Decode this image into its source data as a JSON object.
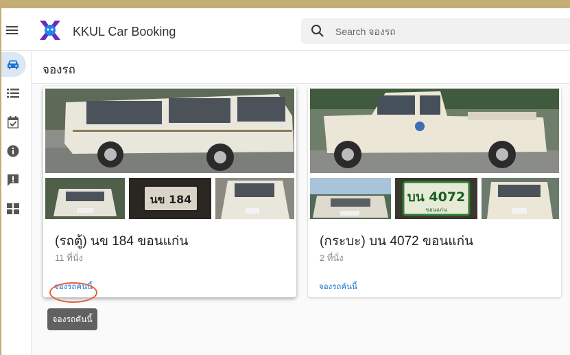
{
  "app": {
    "title": "KKUL Car Booking"
  },
  "search": {
    "placeholder": "Search จองรถ"
  },
  "nav": {
    "items": [
      {
        "icon": "car-icon",
        "active": true
      },
      {
        "icon": "list-icon",
        "active": false
      },
      {
        "icon": "calendar-check-icon",
        "active": false
      },
      {
        "icon": "info-icon",
        "active": false
      },
      {
        "icon": "feedback-icon",
        "active": false
      },
      {
        "icon": "dashboard-icon",
        "active": false
      }
    ]
  },
  "page": {
    "title": "จองรถ"
  },
  "cars": [
    {
      "title": "(รถตู้) นข 184 ขอนแก่น",
      "seats": "11 ที่นั่ง",
      "action": "จองรถคันนี้",
      "plate_photo_text": "นข 184"
    },
    {
      "title": "(กระบะ) บน 4072 ขอนแก่น",
      "seats": "2 ที่นั่ง",
      "action": "จองรถคันนี้",
      "plate_photo_text": "บน 4072",
      "plate_photo_subtext": "ขอนแก่น"
    }
  ],
  "tooltip": {
    "text": "จองรถคันนี้"
  },
  "colors": {
    "accent": "#1976d2",
    "nav_active_bg": "#dde7f3",
    "annotation": "#e65c3b",
    "tooltip_bg": "#616161"
  }
}
